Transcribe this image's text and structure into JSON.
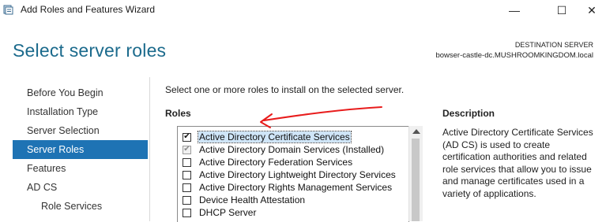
{
  "window": {
    "title": "Add Roles and Features Wizard",
    "controls": {
      "minimize": "—",
      "maximize": "☐",
      "close": "✕"
    }
  },
  "header": {
    "page_title": "Select server roles",
    "destination_label": "DESTINATION SERVER",
    "destination_server": "bowser-castle-dc.MUSHROOMKINGDOM.local"
  },
  "nav": {
    "items": [
      {
        "label": "Before You Begin"
      },
      {
        "label": "Installation Type"
      },
      {
        "label": "Server Selection"
      },
      {
        "label": "Server Roles",
        "active": true
      },
      {
        "label": "Features"
      },
      {
        "label": "AD CS"
      },
      {
        "label": "Role Services"
      }
    ]
  },
  "main": {
    "instruction": "Select one or more roles to install on the selected server.",
    "roles_header": "Roles",
    "roles": [
      {
        "label": "Active Directory Certificate Services",
        "checked": true,
        "selected": true
      },
      {
        "label": "Active Directory Domain Services (Installed)",
        "checked": true,
        "disabled": true
      },
      {
        "label": "Active Directory Federation Services",
        "checked": false
      },
      {
        "label": "Active Directory Lightweight Directory Services",
        "checked": false
      },
      {
        "label": "Active Directory Rights Management Services",
        "checked": false
      },
      {
        "label": "Device Health Attestation",
        "checked": false
      },
      {
        "label": "DHCP Server",
        "checked": false
      }
    ]
  },
  "description": {
    "header": "Description",
    "text": "Active Directory Certificate Services (AD CS) is used to create certification authorities and related role services that allow you to issue and manage certificates used in a variety of applications."
  },
  "colors": {
    "accent": "#1e73b4",
    "title": "#1b6a8c",
    "annotation": "#e81c1c"
  },
  "icons": {
    "app": "server-manager-icon",
    "check": "checkmark-icon",
    "scroll_up": "scroll-up-arrow-icon"
  }
}
